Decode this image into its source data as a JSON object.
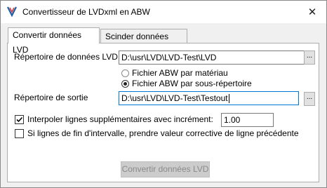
{
  "window": {
    "title": "Convertisseur de LVDxml en ABW",
    "close_glyph": "✕"
  },
  "tabs": [
    {
      "label": "Convertir données LVD",
      "active": true
    },
    {
      "label": "Scinder données LVD",
      "active": false
    }
  ],
  "form": {
    "data_dir_label": "Répertoire de données LVD",
    "data_dir_value": "D:\\usr\\LVD\\LVD-Test\\LVD",
    "browse_label": "...",
    "radio_options": [
      {
        "label": "Fichier ABW par matériau",
        "checked": false
      },
      {
        "label": "Fichier ABW par sous-répertoire",
        "checked": true
      }
    ],
    "output_dir_label": "Répertoire de sortie",
    "output_dir_value": "D:\\usr\\LVD\\LVD-Test\\Testout",
    "interpolate_label": "Interpoler lignes supplémentaires avec incrément:",
    "interpolate_checked": true,
    "increment_value": "1.00",
    "correction_label": "Si lignes de fin d'intervalle, prendre valeur corrective de ligne précédente",
    "correction_checked": false,
    "convert_button_label": "Convertir données LVD",
    "convert_button_enabled": false
  },
  "colors": {
    "focus_border": "#0078d7",
    "disabled_button_bg": "#cccccc",
    "disabled_text": "#8a8a8a"
  }
}
